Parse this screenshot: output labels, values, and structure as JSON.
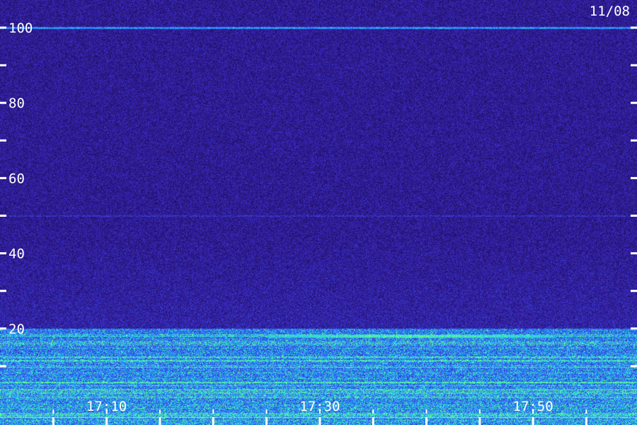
{
  "chart_data": {
    "type": "heatmap",
    "date_label": "11/08",
    "y_axis": {
      "range": [
        0,
        100
      ],
      "major_ticks": [
        20,
        40,
        60,
        80,
        100
      ],
      "major_labels": [
        "20",
        "40",
        "60",
        "80",
        "100"
      ],
      "minor_ticks": [
        10,
        30,
        50,
        70,
        90
      ]
    },
    "x_axis": {
      "range": [
        "17:00",
        "17:59"
      ],
      "tick_labels": [
        {
          "time": "17:10",
          "label": "17:10"
        },
        {
          "time": "17:30",
          "label": "17:30"
        },
        {
          "time": "17:50",
          "label": "17:50"
        }
      ],
      "tick_times": [
        "17:05",
        "17:10",
        "17:15",
        "17:20",
        "17:25",
        "17:30",
        "17:35",
        "17:40",
        "17:45",
        "17:50",
        "17:55"
      ]
    },
    "features": [
      {
        "kind": "steady-line",
        "level": 100
      },
      {
        "kind": "faint-line",
        "level": 50
      },
      {
        "kind": "bright-line",
        "level": 18,
        "from": "17:25",
        "to": "17:52"
      },
      {
        "kind": "intense-band",
        "from_level": 0,
        "to_level": 20
      }
    ],
    "colors": {
      "background": "#1a0a50",
      "noise": "#3a26b8",
      "mid": "#2f6bff",
      "high": "#26d3e6",
      "peak": "#6cff8a",
      "labels": "#ffffff"
    }
  }
}
